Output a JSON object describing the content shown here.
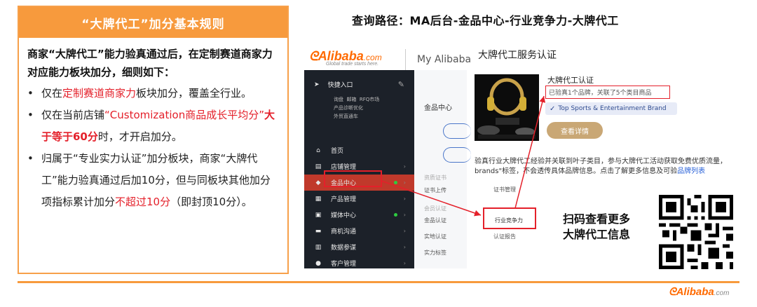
{
  "left_panel": {
    "header": "“大牌代工”加分基本规则",
    "intro": "商家“大牌代工”能力验真通过后，在定制赛道商家力对应能力板块加分，细则如下：",
    "bullet1": {
      "pre": "仅在",
      "red": "定制赛道商家力",
      "post": "板块加分，覆盖全行业。"
    },
    "bullet2": {
      "pre": "仅在当前店铺",
      "red": "“Customization商品成长平均分”",
      "bold_red": "大于等于60分",
      "post": "时，才开启加分。"
    },
    "bullet3": {
      "pre": "归属于“专业实力认证”加分板块，商家“大牌代工”能力验真通过后加10分，但与同板块其他加分项指标累计加分",
      "red": "不超过10分",
      "post": "（即封顶10分）。"
    }
  },
  "path_title": "查询路径：MA后台-金品中心-行业竞争力-大牌代工",
  "top_logo": {
    "word": "Alibaba",
    "dotcom": ".com",
    "tagline": "Global trade starts here.",
    "my": "My Alibaba"
  },
  "sidebar": {
    "quick_title": "快捷入口",
    "quick_links": [
      "询盘",
      "邮箱",
      "RFQ市场",
      "产品诊断优化",
      "外贸直通车"
    ],
    "items": [
      {
        "label": "首页",
        "icon": "home-icon",
        "glyph": "⌂"
      },
      {
        "label": "店铺管理",
        "icon": "store-icon",
        "glyph": "▤"
      },
      {
        "label": "金品中心",
        "icon": "shield-icon",
        "glyph": "◆"
      },
      {
        "label": "产品管理",
        "icon": "grid-icon",
        "glyph": "▦"
      },
      {
        "label": "媒体中心",
        "icon": "media-icon",
        "glyph": "▣"
      },
      {
        "label": "商机沟通",
        "icon": "chat-icon",
        "glyph": "▬"
      },
      {
        "label": "数据参谋",
        "icon": "chart-icon",
        "glyph": "▥"
      },
      {
        "label": "客户管理",
        "icon": "user-icon",
        "glyph": "●"
      }
    ]
  },
  "submenu": {
    "title": "金品中心",
    "g1": "资质证书",
    "a1": "证书上传",
    "g2": "会员认证",
    "a2": "金品认证",
    "a3": "实地认证",
    "a4": "实力标签",
    "t1": "证书管理",
    "t2": "行业竞争力",
    "t3": "认证报告"
  },
  "card": {
    "page_title": "大牌代工服务认证",
    "name": "大牌代工认证",
    "note": "已验真1个品牌，关联了5个类目商品",
    "category": "Top Sports & Entertainment Brand",
    "button": "查看详情",
    "desc": "验真行业大牌代工经验并关联到叶子类目，参与大牌代工活动获取免费优质流量，",
    "desc2": "brands\"标签，不会透传具体品牌信息。点击了解更多信息及可验",
    "link": "品牌列表"
  },
  "qr_text": [
    "扫码查看更多",
    "大牌代工信息"
  ],
  "bottom_logo": {
    "word": "Alibaba",
    "dotcom": ".com"
  },
  "colors": {
    "orange": "#f79a3d",
    "red": "#e4202a",
    "sidebar": "#1c2129",
    "gold": "#c9a775"
  }
}
